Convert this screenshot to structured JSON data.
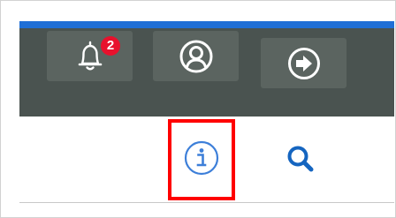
{
  "toolbar": {
    "notifications": {
      "icon": "bell-icon",
      "badge_count": "2",
      "badge_color": "#e8112d"
    },
    "user": {
      "icon": "user-circle-icon"
    },
    "logout": {
      "icon": "logout-arrow-icon"
    }
  },
  "subbar": {
    "info": {
      "icon": "info-icon",
      "highlighted": true,
      "highlight_color": "#ff0000"
    },
    "search": {
      "icon": "search-icon",
      "color": "#1565c0"
    }
  },
  "colors": {
    "accent": "#1f6fd6",
    "toolbar_bg": "#4a5350",
    "button_bg": "#5b6460",
    "info_icon": "#3d7fd9"
  }
}
